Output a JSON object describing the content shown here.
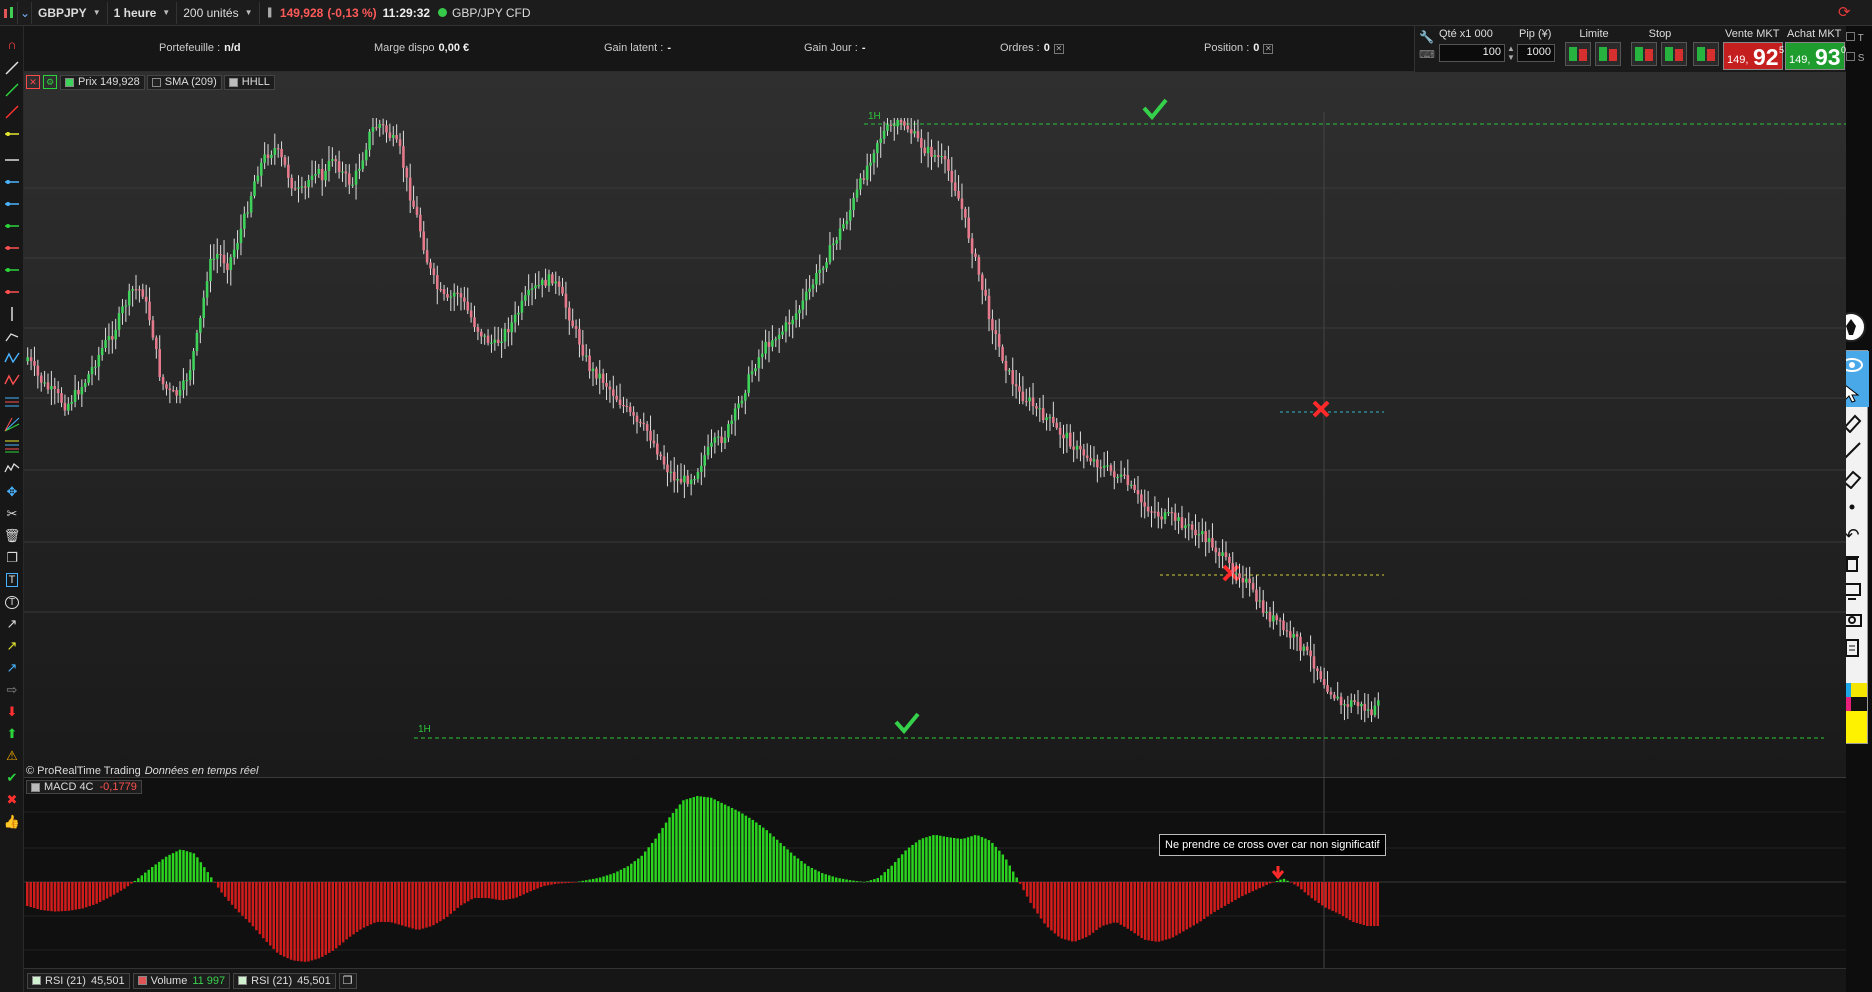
{
  "toolbar": {
    "symbol": "GBPJPY",
    "timeframe": "1 heure",
    "units": "200 unités",
    "price": "149,928",
    "change": "(-0,13 %)",
    "time": "11:29:32",
    "instrument": "GBP/JPY CFD"
  },
  "infobar": {
    "portefeuille_label": "Portefeuille :",
    "portefeuille_value": "n/d",
    "marge_label": "Marge dispo",
    "marge_value": "0,00 €",
    "gain_latent_label": "Gain latent :",
    "gain_latent_value": "-",
    "gain_jour_label": "Gain Jour :",
    "gain_jour_value": "-",
    "ordres_label": "Ordres :",
    "ordres_value": "0",
    "position_label": "Position :",
    "position_value": "0"
  },
  "order_panel": {
    "qty_label": "Qté x1 000",
    "qty_value": "100",
    "pip_label": "Pip (¥)",
    "pip_value": "1000",
    "limit_label": "Limite",
    "stop_label": "Stop",
    "sell_label": "Vente MKT",
    "sell_small": "149,",
    "sell_big": "92",
    "sell_sup": "5",
    "buy_label": "Achat MKT",
    "buy_small": "149,",
    "buy_big": "93",
    "buy_sup": "0",
    "side_t": "T",
    "side_s": "S"
  },
  "legend": {
    "price_label": "Prix",
    "price_value": "149,928",
    "sma_label": "SMA (209)",
    "hhll_label": "HHLL"
  },
  "chart_annotations": {
    "high_tf": "1H",
    "low_tf": "1H"
  },
  "copyright": {
    "vendor": "© ProRealTime Trading",
    "data": "Données en temps réel"
  },
  "macd": {
    "label": "MACD 4C",
    "value": "-0,1779",
    "note": "Ne prendre ce cross over car non significatif"
  },
  "bottom": {
    "rsi1_label": "RSI (21)",
    "rsi1_value": "45,501",
    "volume_label": "Volume",
    "volume_value": "11 997",
    "rsi2_label": "RSI (21)",
    "rsi2_value": "45,501"
  },
  "colors": {
    "up": "#3fd25a",
    "down": "#e67a8c",
    "macd_pos": "#2ad41f",
    "macd_neg": "#d11c1c",
    "check": "#35d14a",
    "cross": "#ff2a2a"
  },
  "price_path": [
    0.62,
    0.59,
    0.57,
    0.56,
    0.54,
    0.56,
    0.58,
    0.61,
    0.64,
    0.66,
    0.7,
    0.73,
    0.73,
    0.67,
    0.58,
    0.56,
    0.56,
    0.6,
    0.67,
    0.77,
    0.79,
    0.77,
    0.81,
    0.86,
    0.92,
    0.95,
    0.96,
    0.93,
    0.89,
    0.89,
    0.93,
    0.91,
    0.95,
    0.92,
    0.9,
    0.94,
    0.99,
    1.0,
    0.98,
    0.96,
    0.89,
    0.84,
    0.77,
    0.73,
    0.71,
    0.73,
    0.7,
    0.67,
    0.65,
    0.64,
    0.66,
    0.68,
    0.71,
    0.73,
    0.74,
    0.75,
    0.72,
    0.68,
    0.64,
    0.6,
    0.59,
    0.57,
    0.55,
    0.53,
    0.51,
    0.5,
    0.47,
    0.44,
    0.42,
    0.42,
    0.43,
    0.46,
    0.48,
    0.49,
    0.52,
    0.56,
    0.6,
    0.63,
    0.65,
    0.66,
    0.68,
    0.7,
    0.73,
    0.76,
    0.79,
    0.82,
    0.85,
    0.89,
    0.93,
    0.97,
    0.99,
    1.0,
    1.0,
    0.98,
    0.96,
    0.95,
    0.94,
    0.91,
    0.86,
    0.8,
    0.74,
    0.68,
    0.63,
    0.59,
    0.56,
    0.55,
    0.53,
    0.52,
    0.5,
    0.49,
    0.47,
    0.46,
    0.45,
    0.44,
    0.43,
    0.42,
    0.4,
    0.38,
    0.37,
    0.36,
    0.36,
    0.35,
    0.34,
    0.33,
    0.32,
    0.3,
    0.28,
    0.27,
    0.25,
    0.22,
    0.2,
    0.19,
    0.17,
    0.16,
    0.14,
    0.12,
    0.09,
    0.07,
    0.05,
    0.06,
    0.05,
    0.04,
    0.06
  ],
  "macd_path": [
    -0.3,
    -0.35,
    -0.37,
    -0.36,
    -0.33,
    -0.27,
    -0.18,
    -0.08,
    0.05,
    0.18,
    0.3,
    0.38,
    0.33,
    0.1,
    -0.15,
    -0.35,
    -0.52,
    -0.72,
    -0.9,
    -0.98,
    -1.0,
    -0.95,
    -0.85,
    -0.7,
    -0.58,
    -0.5,
    -0.5,
    -0.55,
    -0.6,
    -0.55,
    -0.45,
    -0.3,
    -0.2,
    -0.2,
    -0.23,
    -0.2,
    -0.12,
    -0.05,
    -0.02,
    -0.01,
    0.02,
    0.05,
    0.1,
    0.18,
    0.3,
    0.5,
    0.75,
    0.95,
    1.0,
    0.98,
    0.9,
    0.82,
    0.72,
    0.6,
    0.45,
    0.3,
    0.18,
    0.1,
    0.05,
    0.02,
    0.0,
    0.05,
    0.2,
    0.38,
    0.5,
    0.55,
    0.52,
    0.5,
    0.55,
    0.48,
    0.3,
    0.02,
    -0.3,
    -0.55,
    -0.7,
    -0.75,
    -0.68,
    -0.55,
    -0.5,
    -0.6,
    -0.72,
    -0.75,
    -0.7,
    -0.6,
    -0.5,
    -0.38,
    -0.28,
    -0.18,
    -0.1,
    -0.02,
    0.04,
    -0.05,
    -0.2,
    -0.32,
    -0.4,
    -0.5,
    -0.55,
    -0.55
  ]
}
